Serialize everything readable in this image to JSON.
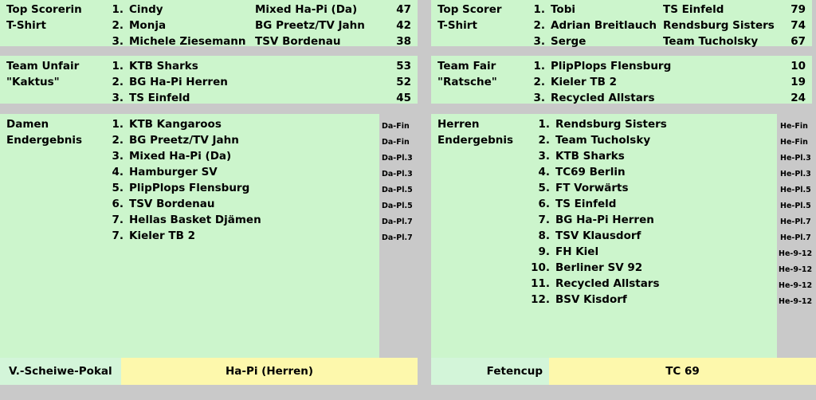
{
  "colors": {
    "background": "#c9c9c9",
    "panel_green": "#ccf5cc",
    "cup_label_green": "#d3f5d9",
    "cup_value_yellow": "#fdf8ac",
    "text": "#000000"
  },
  "left": {
    "top_scorer": {
      "caption_line1": "Top Scorerin",
      "caption_line2": "T-Shirt",
      "rows": [
        {
          "rank": "1.",
          "name": "Cindy",
          "team": "Mixed Ha-Pi (Da)",
          "value": "47"
        },
        {
          "rank": "2.",
          "name": "Monja",
          "team": "BG Preetz/TV Jahn",
          "value": "42"
        },
        {
          "rank": "3.",
          "name": "Michele Ziesemann",
          "team": "TSV Bordenau",
          "value": "38"
        }
      ]
    },
    "team_award": {
      "caption_line1": "Team Unfair",
      "caption_line2": "\"Kaktus\"",
      "rows": [
        {
          "rank": "1.",
          "name": "KTB Sharks",
          "value": "53"
        },
        {
          "rank": "2.",
          "name": "BG Ha-Pi Herren",
          "value": "52"
        },
        {
          "rank": "3.",
          "name": "TS Einfeld",
          "value": "45"
        }
      ]
    },
    "final_standings": {
      "caption_line1": "Damen",
      "caption_line2": "Endergebnis",
      "rows": [
        {
          "rank": "1.",
          "name": "KTB Kangaroos",
          "note": "Da-Fin"
        },
        {
          "rank": "2.",
          "name": "BG Preetz/TV Jahn",
          "note": "Da-Fin"
        },
        {
          "rank": "3.",
          "name": "Mixed Ha-Pi (Da)",
          "note": "Da-Pl.3"
        },
        {
          "rank": "4.",
          "name": "Hamburger SV",
          "note": "Da-Pl.3"
        },
        {
          "rank": "5.",
          "name": "PlipPlops Flensburg",
          "note": "Da-Pl.5"
        },
        {
          "rank": "6.",
          "name": "TSV Bordenau",
          "note": "Da-Pl.5"
        },
        {
          "rank": "7.",
          "name": "Hellas Basket Djämen",
          "note": "Da-Pl.7"
        },
        {
          "rank": "7.",
          "name": "Kieler TB 2",
          "note": "Da-Pl.7"
        }
      ]
    },
    "cup": {
      "label": "V.-Scheiwe-Pokal",
      "winner": "Ha-Pi (Herren)"
    }
  },
  "right": {
    "top_scorer": {
      "caption_line1": "Top Scorer",
      "caption_line2": "T-Shirt",
      "rows": [
        {
          "rank": "1.",
          "name": "Tobi",
          "team": "TS Einfeld",
          "value": "79"
        },
        {
          "rank": "2.",
          "name": "Adrian Breitlauch",
          "team": "Rendsburg Sisters",
          "value": "74"
        },
        {
          "rank": "3.",
          "name": "Serge",
          "team": "Team Tucholsky",
          "value": "67"
        }
      ]
    },
    "team_award": {
      "caption_line1": "Team Fair",
      "caption_line2": "\"Ratsche\"",
      "rows": [
        {
          "rank": "1.",
          "name": "PlipPlops Flensburg",
          "value": "10"
        },
        {
          "rank": "2.",
          "name": "Kieler TB 2",
          "value": "19"
        },
        {
          "rank": "3.",
          "name": "Recycled Allstars",
          "value": "24"
        }
      ]
    },
    "final_standings": {
      "caption_line1": "Herren",
      "caption_line2": "Endergebnis",
      "rows": [
        {
          "rank": "1.",
          "name": "Rendsburg Sisters",
          "note": "He-Fin"
        },
        {
          "rank": "2.",
          "name": "Team Tucholsky",
          "note": "He-Fin"
        },
        {
          "rank": "3.",
          "name": "KTB Sharks",
          "note": "He-Pl.3"
        },
        {
          "rank": "4.",
          "name": "TC69 Berlin",
          "note": "He-Pl.3"
        },
        {
          "rank": "5.",
          "name": "FT Vorwärts",
          "note": "He-Pl.5"
        },
        {
          "rank": "6.",
          "name": "TS Einfeld",
          "note": "He-Pl.5"
        },
        {
          "rank": "7.",
          "name": "BG Ha-Pi Herren",
          "note": "He-Pl.7"
        },
        {
          "rank": "8.",
          "name": "TSV Klausdorf",
          "note": "He-Pl.7"
        },
        {
          "rank": "9.",
          "name": "FH Kiel",
          "note": "He-9-12"
        },
        {
          "rank": "10.",
          "name": "Berliner SV 92",
          "note": "He-9-12"
        },
        {
          "rank": "11.",
          "name": "Recycled Allstars",
          "note": "He-9-12"
        },
        {
          "rank": "12.",
          "name": "BSV Kisdorf",
          "note": "He-9-12"
        }
      ]
    },
    "cup": {
      "label": "Fetencup",
      "winner": "TC 69"
    }
  }
}
